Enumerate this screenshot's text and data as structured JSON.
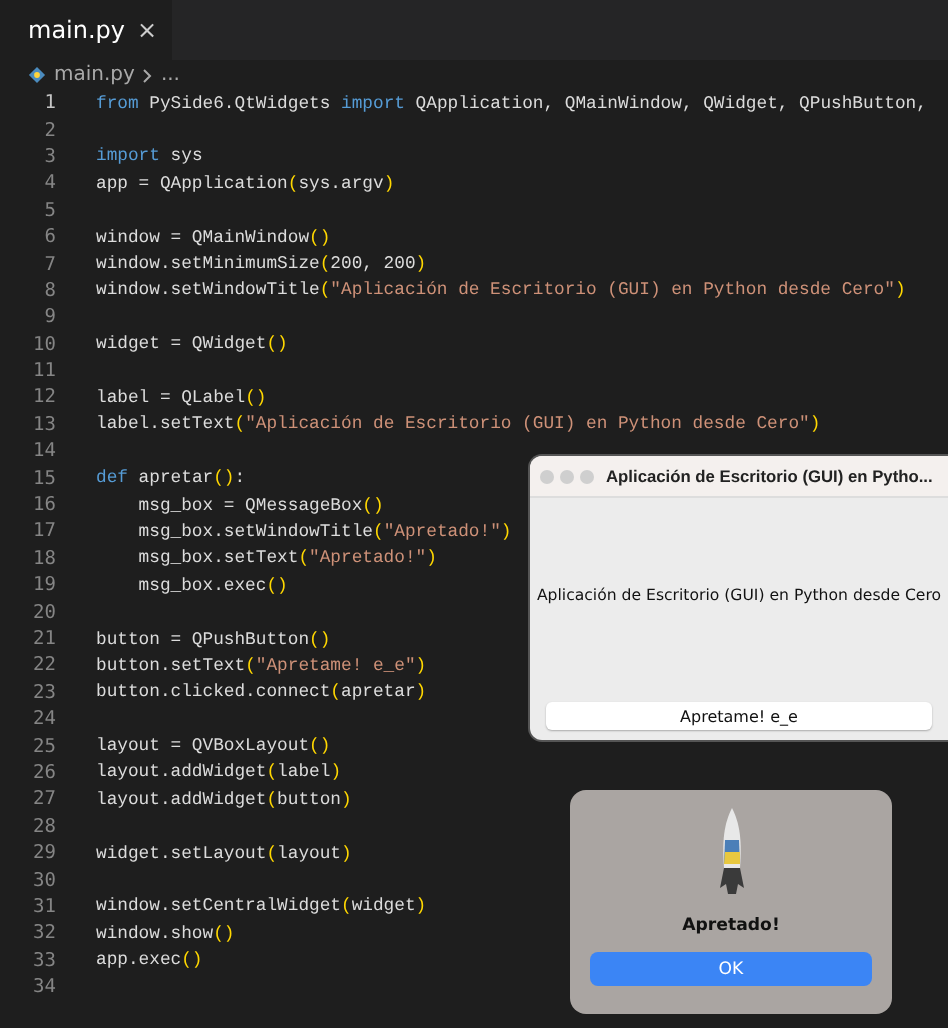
{
  "editor": {
    "tabs": [
      {
        "label": "main.py",
        "selected": true,
        "close": "×"
      }
    ],
    "breadcrumb": [
      "main.py",
      "..."
    ],
    "lines": [
      {
        "number": "1",
        "tokens": [
          {
            "kind": "kw",
            "text": "from"
          },
          {
            "kind": "id",
            "text": " PySide6.QtWidgets "
          },
          {
            "kind": "kw",
            "text": "import"
          },
          {
            "kind": "id",
            "text": " QApplication, QMainWindow, QWidget, QPushButton,"
          }
        ]
      },
      {
        "number": "2"
      },
      {
        "number": "3",
        "tokens": [
          {
            "kind": "kw",
            "text": "import"
          },
          {
            "kind": "id",
            "text": " sys"
          }
        ]
      },
      {
        "number": "4",
        "tokens": [
          {
            "kind": "id",
            "text": "app = QApplication"
          },
          {
            "kind": "br",
            "text": "("
          },
          {
            "kind": "id",
            "text": "sys.argv"
          },
          {
            "kind": "br",
            "text": ")"
          }
        ]
      },
      {
        "number": "5"
      },
      {
        "number": "6",
        "tokens": [
          {
            "kind": "id",
            "text": "window = QMainWindow"
          },
          {
            "kind": "br",
            "text": "()"
          }
        ]
      },
      {
        "number": "7",
        "tokens": [
          {
            "kind": "id",
            "text": "window.setMinimumSize"
          },
          {
            "kind": "br",
            "text": "("
          },
          {
            "kind": "id",
            "text": "200, 200"
          },
          {
            "kind": "br",
            "text": ")"
          }
        ]
      },
      {
        "number": "8",
        "tokens": [
          {
            "kind": "id",
            "text": "window.setWindowTitle"
          },
          {
            "kind": "br",
            "text": "("
          },
          {
            "kind": "str",
            "text": "\"Aplicación de Escritorio (GUI) en Python desde Cero\""
          },
          {
            "kind": "br",
            "text": ")"
          }
        ]
      },
      {
        "number": "9"
      },
      {
        "number": "10",
        "tokens": [
          {
            "kind": "id",
            "text": "widget = QWidget"
          },
          {
            "kind": "br",
            "text": "()"
          }
        ]
      },
      {
        "number": "11"
      },
      {
        "number": "12",
        "tokens": [
          {
            "kind": "id",
            "text": "label = QLabel"
          },
          {
            "kind": "br",
            "text": "()"
          }
        ]
      },
      {
        "number": "13",
        "tokens": [
          {
            "kind": "id",
            "text": "label.setText"
          },
          {
            "kind": "br",
            "text": "("
          },
          {
            "kind": "str",
            "text": "\"Aplicación de Escritorio (GUI) en Python desde Cero\""
          },
          {
            "kind": "br",
            "text": ")"
          }
        ]
      },
      {
        "number": "14"
      },
      {
        "number": "15",
        "tokens": [
          {
            "kind": "kw",
            "text": "def"
          },
          {
            "kind": "id",
            "text": " apretar"
          },
          {
            "kind": "br",
            "text": "()"
          },
          {
            "kind": "id",
            "text": ":"
          }
        ]
      },
      {
        "number": "16",
        "tokens": [
          {
            "kind": "id",
            "text": "    msg_box = QMessageBox"
          },
          {
            "kind": "br",
            "text": "()"
          }
        ]
      },
      {
        "number": "17",
        "tokens": [
          {
            "kind": "id",
            "text": "    msg_box.setWindowTitle"
          },
          {
            "kind": "br",
            "text": "("
          },
          {
            "kind": "str",
            "text": "\"Apretado!\""
          },
          {
            "kind": "br",
            "text": ")"
          }
        ]
      },
      {
        "number": "18",
        "tokens": [
          {
            "kind": "id",
            "text": "    msg_box.setText"
          },
          {
            "kind": "br",
            "text": "("
          },
          {
            "kind": "str",
            "text": "\"Apretado!\""
          },
          {
            "kind": "br",
            "text": ")"
          }
        ]
      },
      {
        "number": "19",
        "tokens": [
          {
            "kind": "id",
            "text": "    msg_box.exec"
          },
          {
            "kind": "br",
            "text": "()"
          }
        ]
      },
      {
        "number": "20"
      },
      {
        "number": "21",
        "tokens": [
          {
            "kind": "id",
            "text": "button = QPushButton"
          },
          {
            "kind": "br",
            "text": "()"
          }
        ]
      },
      {
        "number": "22",
        "tokens": [
          {
            "kind": "id",
            "text": "button.setText"
          },
          {
            "kind": "br",
            "text": "("
          },
          {
            "kind": "str",
            "text": "\"Apretame! e_e\""
          },
          {
            "kind": "br",
            "text": ")"
          }
        ]
      },
      {
        "number": "23",
        "tokens": [
          {
            "kind": "id",
            "text": "button.clicked.connect"
          },
          {
            "kind": "br",
            "text": "("
          },
          {
            "kind": "id",
            "text": "apretar"
          },
          {
            "kind": "br",
            "text": ")"
          }
        ]
      },
      {
        "number": "24"
      },
      {
        "number": "25",
        "tokens": [
          {
            "kind": "id",
            "text": "layout = QVBoxLayout"
          },
          {
            "kind": "br",
            "text": "()"
          }
        ]
      },
      {
        "number": "26",
        "tokens": [
          {
            "kind": "id",
            "text": "layout.addWidget"
          },
          {
            "kind": "br",
            "text": "("
          },
          {
            "kind": "id",
            "text": "label"
          },
          {
            "kind": "br",
            "text": ")"
          }
        ]
      },
      {
        "number": "27",
        "tokens": [
          {
            "kind": "id",
            "text": "layout.addWidget"
          },
          {
            "kind": "br",
            "text": "("
          },
          {
            "kind": "id",
            "text": "button"
          },
          {
            "kind": "br",
            "text": ")"
          }
        ]
      },
      {
        "number": "28"
      },
      {
        "number": "29",
        "tokens": [
          {
            "kind": "id",
            "text": "widget.setLayout"
          },
          {
            "kind": "br",
            "text": "("
          },
          {
            "kind": "id",
            "text": "layout"
          },
          {
            "kind": "br",
            "text": ")"
          }
        ]
      },
      {
        "number": "30"
      },
      {
        "number": "31",
        "tokens": [
          {
            "kind": "id",
            "text": "window.setCentralWidget"
          },
          {
            "kind": "br",
            "text": "("
          },
          {
            "kind": "id",
            "text": "widget"
          },
          {
            "kind": "br",
            "text": ")"
          }
        ]
      },
      {
        "number": "32",
        "tokens": [
          {
            "kind": "id",
            "text": "window.show"
          },
          {
            "kind": "br",
            "text": "()"
          }
        ]
      },
      {
        "number": "33",
        "tokens": [
          {
            "kind": "id",
            "text": "app.exec"
          },
          {
            "kind": "br",
            "text": "()"
          }
        ]
      },
      {
        "number": "34"
      }
    ]
  },
  "qt_window": {
    "title": "Aplicación de Escritorio (GUI) en Pytho...",
    "label": "Aplicación de Escritorio (GUI) en Python desde Cero",
    "button": "Apretame! e_e"
  },
  "message_box": {
    "text": "Apretado!",
    "button": "OK"
  }
}
